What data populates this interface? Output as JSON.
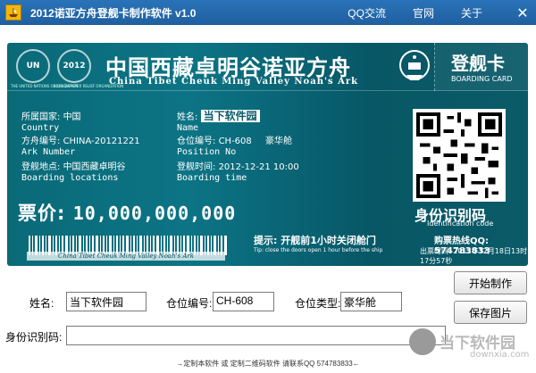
{
  "window": {
    "title": "2012诺亚方舟登舰卡制作软件 v1.0",
    "menu": [
      "QQ交流",
      "官网",
      "关于"
    ],
    "close": "✕"
  },
  "ticket": {
    "org_emblem": "UN",
    "org_caption": "THE UNITED NATIONS ORGANIZATION",
    "year_emblem": "2012",
    "year_caption": "2012 DISASTER RELIEF ORGANIZATION",
    "title_cn": "中国西藏卓明谷诺亚方舟",
    "title_en": "China Tibet Cheuk Ming Valley Noah's Ark",
    "boarding_cn": "登舰卡",
    "boarding_en": "BOARDING CARD",
    "country_label_cn": "所属国家:",
    "country_value": "中国",
    "country_label_en": "Country",
    "name_label_cn": "姓名:",
    "name_value": "当下软件园",
    "name_label_en": "Name",
    "ark_label_cn": "方舟编号:",
    "ark_value": "CHINA-20121221",
    "ark_label_en": "Ark Number",
    "position_label_cn": "仓位编号:",
    "position_value": "CH-608",
    "position_class": "豪华舱",
    "position_label_en": "Position No",
    "location_label_cn": "登舰地点:",
    "location_value": "中国西藏卓明谷",
    "location_label_en": "Boarding locations",
    "time_label_cn": "登舰时间:",
    "time_value": "2012-12-21 10:00",
    "time_label_en": "Boarding time",
    "price_label": "票价:",
    "price_value": "10,000,000,000",
    "id_cn": "身份识别码",
    "id_en": "Identification code",
    "hotline": "购票热线QQ: 574783833",
    "issue_time": "出票时间: 2012年12月18日13时17分57秒",
    "barcode_text": "China Tibet Cheuk Ming Valley Noah's Ark",
    "tip_cn": "提示: 开舰前1小时关闭舱门",
    "tip_en": "Tip: close the doors open 1 hour before the ship"
  },
  "form": {
    "name_label": "姓名:",
    "name_value": "当下软件园",
    "position_label": "仓位编号:",
    "position_value": "CH-608",
    "class_label": "仓位类型:",
    "class_value": "豪华舱",
    "id_label": "身份识别码:",
    "id_value": ""
  },
  "buttons": {
    "start": "开始制作",
    "save": "保存图片"
  },
  "footer": "→定制本软件 或 定制二维码软件 请联系QQ 574783833←",
  "watermark": {
    "cn": "当下软件园",
    "en": "downxia.com"
  },
  "colors": {
    "ticket_teal": "#0a6a78",
    "titlebar_blue": "#2a73b8"
  }
}
